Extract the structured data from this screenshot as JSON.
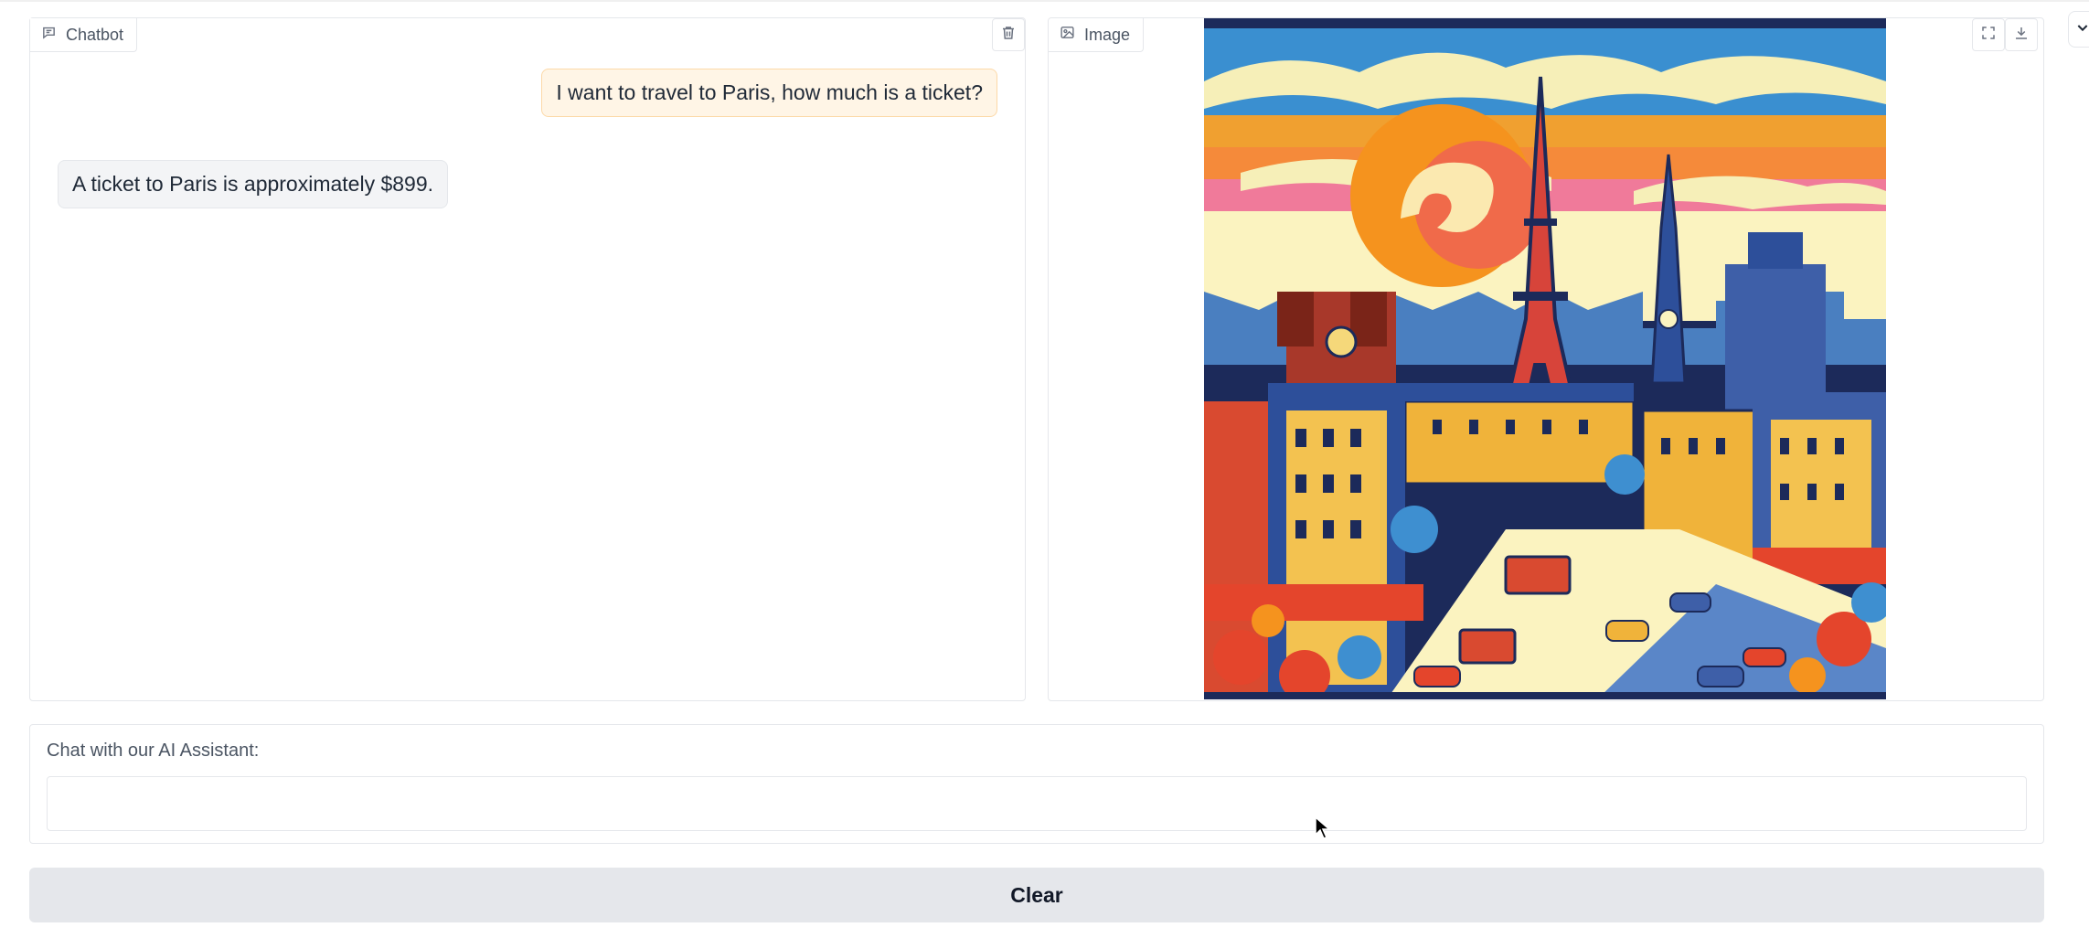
{
  "chatbot": {
    "label": "Chatbot",
    "label_icon": "chat-bubble-icon",
    "clear_icon": "trash-icon",
    "messages": [
      {
        "role": "user",
        "text": "I want to travel to Paris, how much is a ticket?"
      },
      {
        "role": "bot",
        "text": "A ticket to Paris is approximately $899."
      }
    ]
  },
  "image_panel": {
    "label": "Image",
    "label_icon": "image-icon",
    "fullscreen_icon": "fullscreen-icon",
    "download_icon": "download-icon",
    "image_subject": "Pop-art illustration of Paris with the Eiffel Tower, Notre-Dame, orange swirl sun, buildings, buses and cars"
  },
  "input": {
    "label": "Chat with our AI Assistant:",
    "value": "",
    "placeholder": ""
  },
  "clear_button": {
    "label": "Clear"
  },
  "colors": {
    "user_bubble_bg": "#fff5e6",
    "user_bubble_border": "#fcd9a8",
    "bot_bubble_bg": "#f3f4f6",
    "button_bg": "#e5e7eb",
    "border": "#e5e7eb"
  }
}
